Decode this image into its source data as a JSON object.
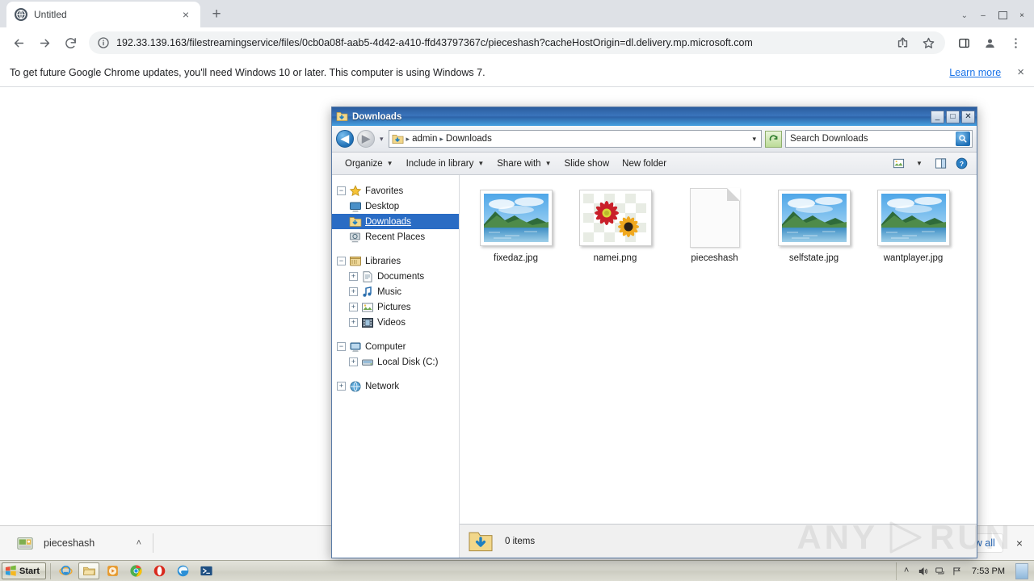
{
  "browser": {
    "tab": {
      "title": "Untitled",
      "favicon": "globe-icon",
      "close": "×"
    },
    "new_tab_label": "+",
    "nav": {
      "back": "back-icon",
      "forward": "forward-icon",
      "reload": "reload-icon"
    },
    "omnibox": {
      "url": "192.33.139.163/filestreamingservice/files/0cb0a08f-aab5-4d42-a410-ffd43797367c/pieceshash?cacheHostOrigin=dl.delivery.mp.microsoft.com",
      "info_icon": "info-circle-icon",
      "share_icon": "share-icon",
      "star_icon": "bookmark-star-icon",
      "sidepanel_icon": "side-panel-icon",
      "profile_icon": "profile-avatar-icon",
      "menu_icon": "three-dot-menu-icon"
    },
    "infobar": {
      "message": "To get future Google Chrome updates, you'll need Windows 10 or later. This computer is using Windows 7.",
      "link": "Learn more",
      "close": "×"
    },
    "download_shelf": {
      "item_name": "pieceshash",
      "item_chevron": "˄",
      "show_all": "Show all",
      "close": "×"
    },
    "window_controls": {
      "minimize": "–",
      "maximize": "□",
      "close": "×",
      "chevron": "⌄"
    }
  },
  "explorer": {
    "title": "Downloads",
    "window_controls": {
      "minimize": "_",
      "maximize": "□",
      "close": "✕"
    },
    "nav": {
      "back": "◀",
      "forward": "▶",
      "history_dropdown": "▾",
      "breadcrumb": [
        "admin",
        "Downloads"
      ],
      "breadcrumb_separator": "▸",
      "address_caret": "▾",
      "refresh": "refresh-icon"
    },
    "search": {
      "placeholder": "Search Downloads",
      "button_icon": "search-magnifier-icon"
    },
    "toolbar": {
      "items": [
        {
          "label": "Organize",
          "has_arrow": true
        },
        {
          "label": "Include in library",
          "has_arrow": true
        },
        {
          "label": "Share with",
          "has_arrow": true
        },
        {
          "label": "Slide show",
          "has_arrow": false
        },
        {
          "label": "New folder",
          "has_arrow": false
        }
      ],
      "view_icon": "view-layout-icon",
      "view_arrow": "▾",
      "preview_icon": "preview-pane-icon",
      "help_icon": "help-question-icon"
    },
    "sidebar": {
      "groups": [
        {
          "label": "Favorites",
          "icon": "star-icon",
          "expander": "−",
          "items": [
            {
              "label": "Desktop",
              "icon": "desktop-icon",
              "expander": "",
              "selected": false
            },
            {
              "label": "Downloads",
              "icon": "downloads-folder-icon",
              "expander": "",
              "selected": true
            },
            {
              "label": "Recent Places",
              "icon": "recent-places-icon",
              "expander": "",
              "selected": false
            }
          ]
        },
        {
          "label": "Libraries",
          "icon": "libraries-icon",
          "expander": "−",
          "items": [
            {
              "label": "Documents",
              "icon": "documents-icon",
              "expander": "+",
              "selected": false
            },
            {
              "label": "Music",
              "icon": "music-note-icon",
              "expander": "+",
              "selected": false
            },
            {
              "label": "Pictures",
              "icon": "pictures-icon",
              "expander": "+",
              "selected": false
            },
            {
              "label": "Videos",
              "icon": "videos-film-icon",
              "expander": "+",
              "selected": false
            }
          ]
        },
        {
          "label": "Computer",
          "icon": "computer-icon",
          "expander": "−",
          "items": [
            {
              "label": "Local Disk (C:)",
              "icon": "hard-disk-icon",
              "expander": "+",
              "selected": false
            }
          ]
        },
        {
          "label": "Network",
          "icon": "network-icon",
          "expander": "+",
          "items": []
        }
      ]
    },
    "files": [
      {
        "name": "fixedaz.jpg",
        "type": "photo-landscape"
      },
      {
        "name": "namei.png",
        "type": "photo-flowers"
      },
      {
        "name": "pieceshash",
        "type": "blank-document"
      },
      {
        "name": "selfstate.jpg",
        "type": "photo-landscape"
      },
      {
        "name": "wantplayer.jpg",
        "type": "photo-landscape"
      }
    ],
    "status": {
      "icon": "downloads-folder-icon",
      "text": "0 items"
    }
  },
  "taskbar": {
    "start_label": "Start",
    "quick_launch": [
      {
        "name": "internet-explorer-icon",
        "active": false
      },
      {
        "name": "windows-explorer-icon",
        "active": true
      },
      {
        "name": "media-player-icon",
        "active": false
      },
      {
        "name": "google-chrome-icon",
        "active": false
      },
      {
        "name": "opera-icon",
        "active": false
      },
      {
        "name": "microsoft-edge-icon",
        "active": false
      },
      {
        "name": "powershell-icon",
        "active": false
      }
    ],
    "tray": {
      "show_hidden": "˄",
      "volume_icon": "volume-speaker-icon",
      "network_icon": "network-tray-icon",
      "action_icon": "action-flag-icon",
      "clock": "7:53 PM"
    }
  },
  "watermark": {
    "left": "ANY",
    "right": "RUN"
  }
}
